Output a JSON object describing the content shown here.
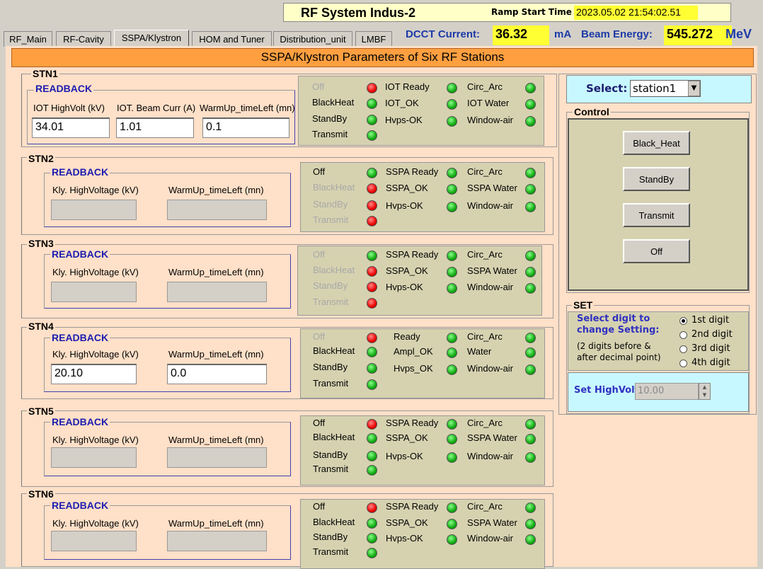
{
  "header": {
    "title": "RF System  Indus-2",
    "ramp_label": "Ramp Start Time",
    "ramp_value": "2023.05.02 21:54:02.51"
  },
  "tabs": [
    "RF_Main",
    "RF-Cavity",
    "SSPA/Klystron",
    "HOM and Tuner",
    "Distribution_unit",
    "LMBF"
  ],
  "active_tab": "SSPA/Klystron",
  "dcct": {
    "label": "DCCT Current:",
    "value": "36.32",
    "unit": "mA"
  },
  "beam": {
    "label": "Beam Energy:",
    "value": "545.272",
    "unit": "MeV"
  },
  "banner": "SSPA/Klystron Parameters of Six RF Stations",
  "stations": [
    {
      "name": "STN1",
      "readback": "READBACK",
      "fields": [
        {
          "label": "IOT HighVolt (kV)",
          "value": "34.01"
        },
        {
          "label": "IOT. Beam Curr (A)",
          "value": "1.01"
        },
        {
          "label": "WarmUp_timeLeft (mn)",
          "value": "0.1"
        }
      ],
      "status": [
        [
          {
            "label": "Off",
            "led": "red",
            "dim": true
          },
          {
            "label": "BlackHeat",
            "led": "green",
            "dim": false
          },
          {
            "label": "StandBy",
            "led": "green",
            "dim": false
          },
          {
            "label": "Transmit",
            "led": "green",
            "dim": false
          }
        ],
        [
          {
            "label": "IOT Ready",
            "led": "green"
          },
          {
            "label": "IOT_OK",
            "led": "green"
          },
          {
            "label": "Hvps-OK",
            "led": "green"
          }
        ],
        [
          {
            "label": "Circ_Arc",
            "led": "green"
          },
          {
            "label": "IOT Water",
            "led": "green"
          },
          {
            "label": "Window-air",
            "led": "green"
          }
        ]
      ]
    },
    {
      "name": "STN2",
      "readback": "READBACK",
      "fields": [
        {
          "label": "Kly. HighVoltage (kV)",
          "value": ""
        },
        {
          "label": "WarmUp_timeLeft (mn)",
          "value": ""
        }
      ],
      "status": [
        [
          {
            "label": "Off",
            "led": "green",
            "dim": false
          },
          {
            "label": "BlackHeat",
            "led": "red",
            "dim": true
          },
          {
            "label": "StandBy",
            "led": "red",
            "dim": true
          },
          {
            "label": "Transmit",
            "led": "red",
            "dim": true
          }
        ],
        [
          {
            "label": "SSPA Ready",
            "led": "green"
          },
          {
            "label": "SSPA_OK",
            "led": "green"
          },
          {
            "label": "Hvps-OK",
            "led": "green"
          }
        ],
        [
          {
            "label": "Circ_Arc",
            "led": "green"
          },
          {
            "label": "SSPA Water",
            "led": "green"
          },
          {
            "label": "Window-air",
            "led": "green"
          }
        ]
      ]
    },
    {
      "name": "STN3",
      "readback": "READBACK",
      "fields": [
        {
          "label": "Kly. HighVoltage (kV)",
          "value": ""
        },
        {
          "label": "WarmUp_timeLeft (mn)",
          "value": ""
        }
      ],
      "status": [
        [
          {
            "label": "Off",
            "led": "green",
            "dim": true
          },
          {
            "label": "BlackHeat",
            "led": "red",
            "dim": true
          },
          {
            "label": "StandBy",
            "led": "red",
            "dim": true
          },
          {
            "label": "Transmit",
            "led": "red",
            "dim": true
          }
        ],
        [
          {
            "label": "SSPA Ready",
            "led": "green"
          },
          {
            "label": "SSPA_OK",
            "led": "green"
          },
          {
            "label": "Hvps-OK",
            "led": "green"
          }
        ],
        [
          {
            "label": "Circ_Arc",
            "led": "green"
          },
          {
            "label": "SSPA Water",
            "led": "green"
          },
          {
            "label": "Window-air",
            "led": "green"
          }
        ]
      ]
    },
    {
      "name": "STN4",
      "readback": "READBACK",
      "fields": [
        {
          "label": "Kly. HighVoltage (kV)",
          "value": "20.10"
        },
        {
          "label": "WarmUp_timeLeft (mn)",
          "value": "0.0"
        }
      ],
      "status": [
        [
          {
            "label": "Off",
            "led": "red",
            "dim": true
          },
          {
            "label": "BlackHeat",
            "led": "green",
            "dim": false
          },
          {
            "label": "StandBy",
            "led": "green",
            "dim": false
          },
          {
            "label": "Transmit",
            "led": "green",
            "dim": false
          }
        ],
        [
          {
            "label": "Ready",
            "led": "green"
          },
          {
            "label": "Ampl_OK",
            "led": "green"
          },
          {
            "label": "Hvps_OK",
            "led": "green"
          }
        ],
        [
          {
            "label": "Circ_Arc",
            "led": "green"
          },
          {
            "label": "Water",
            "led": "green"
          },
          {
            "label": "Window-air",
            "led": "green"
          }
        ]
      ]
    },
    {
      "name": "STN5",
      "readback": "READBACK",
      "fields": [
        {
          "label": "Kly. HighVoltage (kV)",
          "value": ""
        },
        {
          "label": "WarmUp_timeLeft (mn)",
          "value": ""
        }
      ],
      "status": [
        [
          {
            "label": "Off",
            "led": "red",
            "dim": false
          },
          {
            "label": "BlackHeat",
            "led": "green",
            "dim": false
          },
          {
            "label": "StandBy",
            "led": "green",
            "dim": false
          },
          {
            "label": "Transmit",
            "led": "green",
            "dim": false
          }
        ],
        [
          {
            "label": "SSPA Ready",
            "led": "green"
          },
          {
            "label": "SSPA_OK",
            "led": "green"
          },
          {
            "label": "Hvps-OK",
            "led": "green"
          }
        ],
        [
          {
            "label": "Circ_Arc",
            "led": "green"
          },
          {
            "label": "SSPA Water",
            "led": "green"
          },
          {
            "label": "Window-air",
            "led": "green"
          }
        ]
      ]
    },
    {
      "name": "STN6",
      "readback": "READBACK",
      "fields": [
        {
          "label": "Kly. HighVoltage (kV)",
          "value": ""
        },
        {
          "label": "WarmUp_timeLeft (mn)",
          "value": ""
        }
      ],
      "status": [
        [
          {
            "label": "Off",
            "led": "red",
            "dim": false
          },
          {
            "label": "BlackHeat",
            "led": "green",
            "dim": false
          },
          {
            "label": "StandBy",
            "led": "green",
            "dim": false
          },
          {
            "label": "Transmit",
            "led": "green",
            "dim": false
          }
        ],
        [
          {
            "label": "SSPA Ready",
            "led": "green"
          },
          {
            "label": "SSPA_OK",
            "led": "green"
          },
          {
            "label": "Hvps-OK",
            "led": "green"
          }
        ],
        [
          {
            "label": "Circ_Arc",
            "led": "green"
          },
          {
            "label": "SSPA Water",
            "led": "green"
          },
          {
            "label": "Window-air",
            "led": "green"
          }
        ]
      ]
    }
  ],
  "select": {
    "label": "Select:",
    "value": "station1"
  },
  "control": {
    "title": "Control",
    "buttons": [
      "Black_Heat",
      "StandBy",
      "Transmit",
      "Off"
    ]
  },
  "set": {
    "title": "SET",
    "select_label": "Select digit to change Setting:",
    "note": "(2 digits before & after decimal point)",
    "digits": [
      "1st digit",
      "2nd digit",
      "3rd digit",
      "4th digit"
    ],
    "selected_digit": "1st digit",
    "hv_label": "Set HighVolt",
    "hv_value": "10.00"
  },
  "colors": {
    "panel_bg": "#ffe0c8",
    "banner_bg": "#ff9f40",
    "status_bg": "#d6d2b0",
    "highlight": "#ffff33",
    "led_green": "#11aa11",
    "led_red": "#ee0000"
  }
}
